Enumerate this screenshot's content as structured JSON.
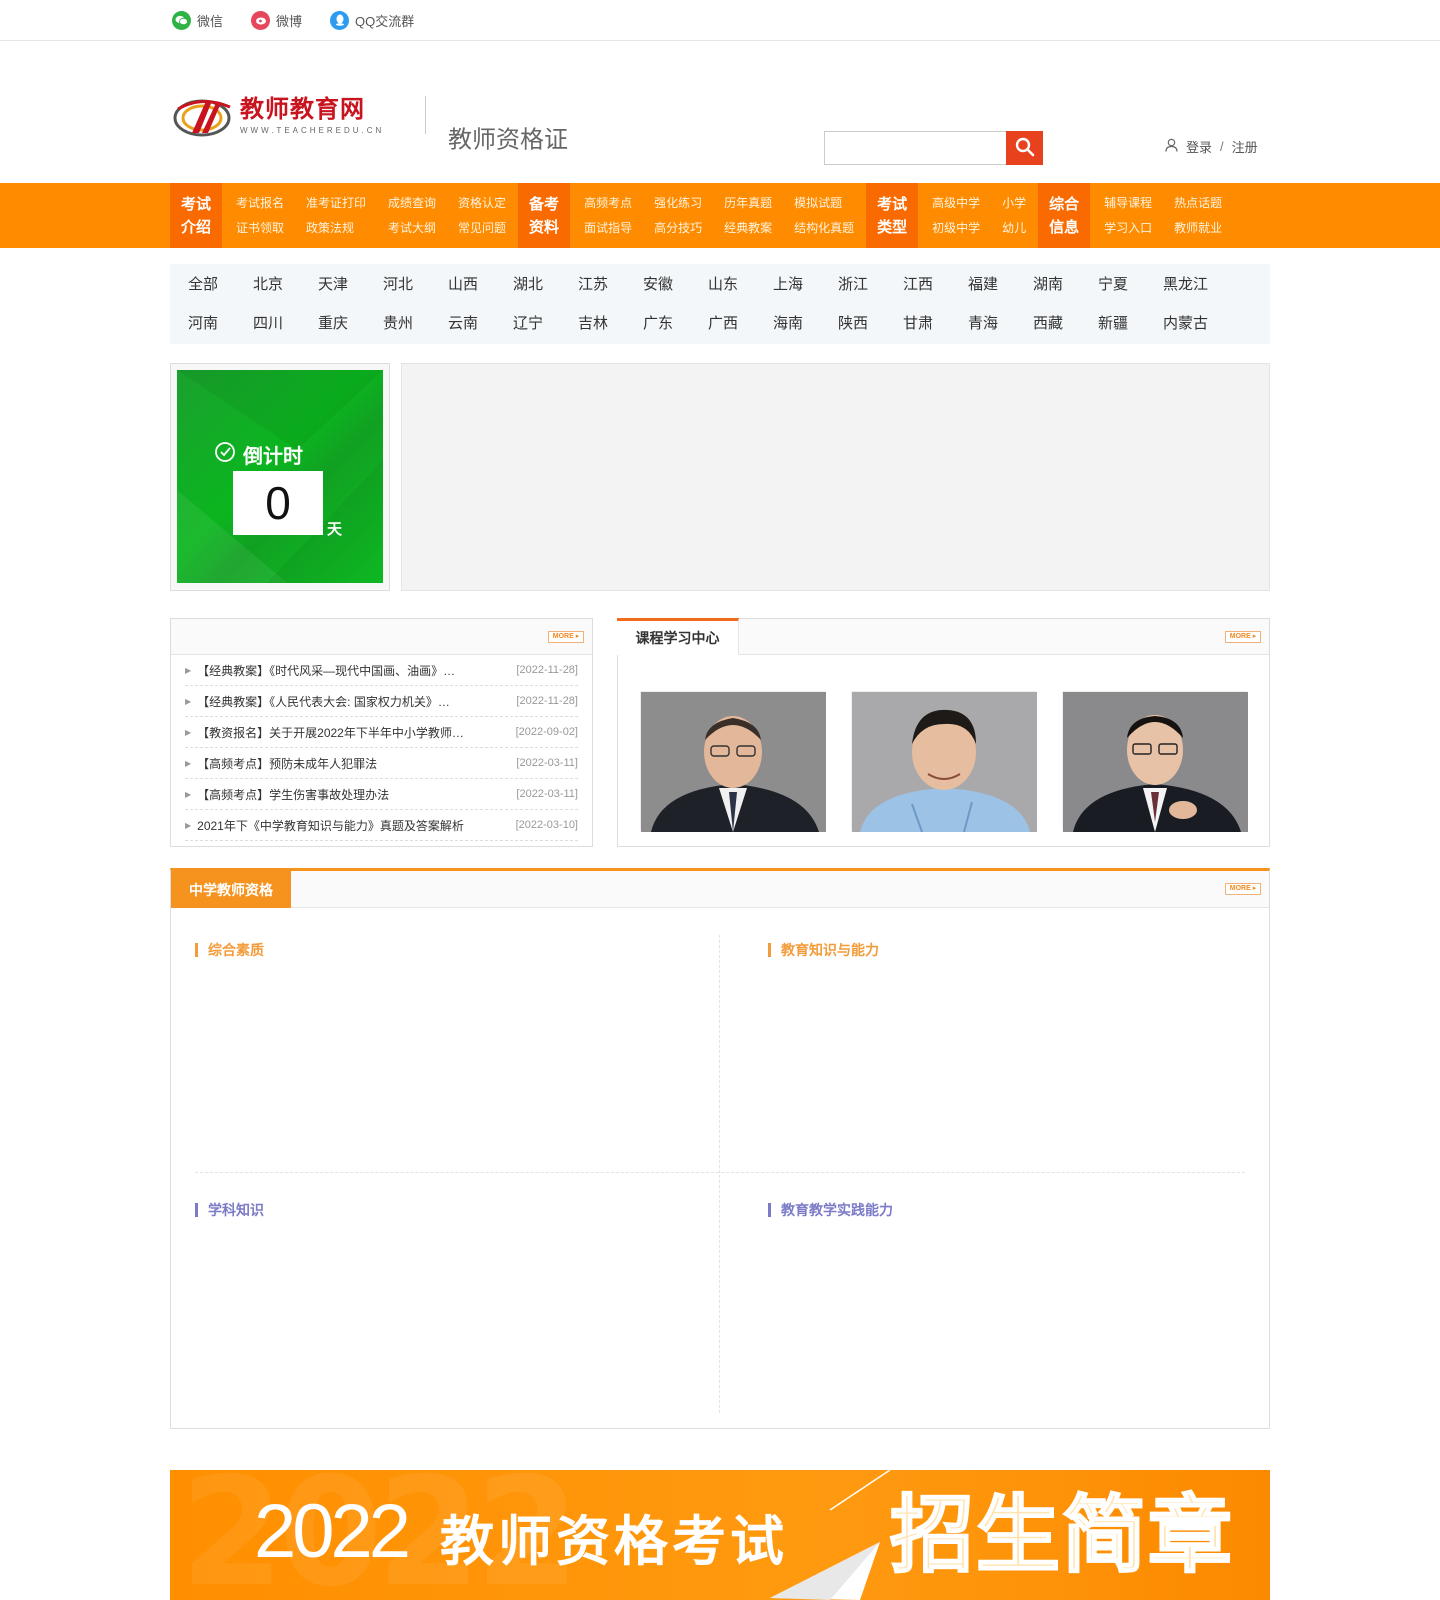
{
  "social": [
    {
      "label": "微信",
      "icon": "wechat-icon"
    },
    {
      "label": "微博",
      "icon": "weibo-icon"
    },
    {
      "label": "QQ交流群",
      "icon": "qq-icon"
    }
  ],
  "header": {
    "logo_cn": "教师教育网",
    "logo_en": "WWW.TEACHEREDU.CN",
    "subtitle": "教师资格证",
    "search_placeholder": "",
    "login": "登录",
    "separator": "/",
    "register": "注册"
  },
  "nav": [
    {
      "cat": [
        "考试",
        "介绍"
      ],
      "links": [
        "考试报名",
        "证书领取",
        "准考证打印",
        "政策法规",
        "成绩查询",
        "考试大纲",
        "资格认定",
        "常见问题"
      ]
    },
    {
      "cat": [
        "备考",
        "资料"
      ],
      "links": [
        "高频考点",
        "面试指导",
        "强化练习",
        "高分技巧",
        "历年真题",
        "经典教案",
        "模拟试题",
        "结构化真题"
      ]
    },
    {
      "cat": [
        "考试",
        "类型"
      ],
      "links": [
        "高级中学",
        "初级中学",
        "小学",
        "幼儿"
      ]
    },
    {
      "cat": [
        "综合",
        "信息"
      ],
      "links": [
        "辅导课程",
        "学习入口",
        "热点话题",
        "教师就业"
      ]
    }
  ],
  "provinces": [
    "全部",
    "北京",
    "天津",
    "河北",
    "山西",
    "湖北",
    "江苏",
    "安徽",
    "山东",
    "上海",
    "浙江",
    "江西",
    "福建",
    "湖南",
    "宁夏",
    "黑龙江",
    "河南",
    "四川",
    "重庆",
    "贵州",
    "云南",
    "辽宁",
    "吉林",
    "广东",
    "广西",
    "海南",
    "陕西",
    "甘肃",
    "青海",
    "西藏",
    "新疆",
    "内蒙古"
  ],
  "countdown": {
    "label": "倒计时",
    "value": "0",
    "unit": "天"
  },
  "more_label": "MORE",
  "news": [
    {
      "title": "【经典教案】《时代风采—现代中国画、油画》…",
      "date": "[2022-11-28]"
    },
    {
      "title": "【经典教案】《人民代表大会: 国家权力机关》…",
      "date": "[2022-11-28]"
    },
    {
      "title": "【教资报名】关于开展2022年下半年中小学教师…",
      "date": "[2022-09-02]"
    },
    {
      "title": "【高频考点】预防未成年人犯罪法",
      "date": "[2022-03-11]"
    },
    {
      "title": "【高频考点】学生伤害事故处理办法",
      "date": "[2022-03-11]"
    },
    {
      "title": "2021年下《中学教育知识与能力》真题及答案解析",
      "date": "[2022-03-10]"
    }
  ],
  "course": {
    "title": "课程学习中心"
  },
  "section": {
    "title": "中学教师资格",
    "subs": [
      "综合素质",
      "教育知识与能力",
      "学科知识",
      "教育教学实践能力"
    ]
  },
  "bottom_banner": {
    "year": "2022",
    "title": "教师资格考试",
    "promo": "招生简章"
  },
  "colors": {
    "orange": "#ff8c00",
    "nav_cat": "#f96a00",
    "search_btn": "#e8411e",
    "countdown_green": "#11a022"
  }
}
